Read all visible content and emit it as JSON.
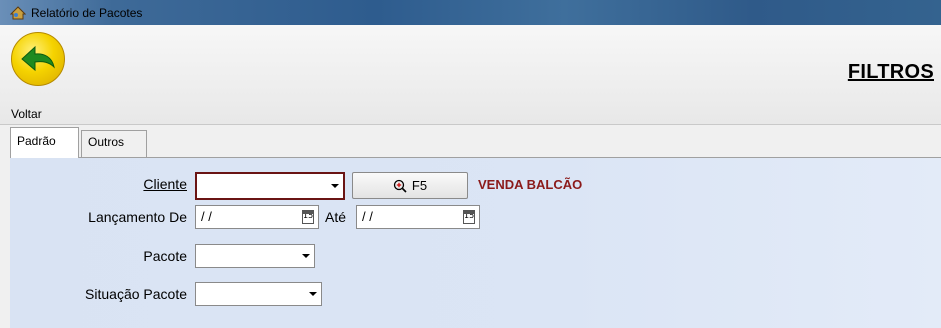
{
  "window": {
    "title": "Relatório de Pacotes"
  },
  "toolbar": {
    "back_label": "Voltar",
    "section_title": "FILTROS"
  },
  "tabs": [
    {
      "label": "Padrão"
    },
    {
      "label": "Outros"
    }
  ],
  "form": {
    "cliente": {
      "label": "Cliente",
      "value": "",
      "search_button": "F5",
      "status_text": "VENDA BALCÃO"
    },
    "lancamento": {
      "label_from": "Lançamento De",
      "from_value": " / /",
      "label_to": "Até",
      "to_value": " / /"
    },
    "pacote": {
      "label": "Pacote",
      "value": ""
    },
    "situacao": {
      "label": "Situação Pacote",
      "value": ""
    }
  },
  "colors": {
    "panel": "#dbe5f5",
    "status_text": "#8b1a1a",
    "focused_border": "#6a1414",
    "back_icon": "#f5d300",
    "arrow": "#1f8a1f"
  }
}
